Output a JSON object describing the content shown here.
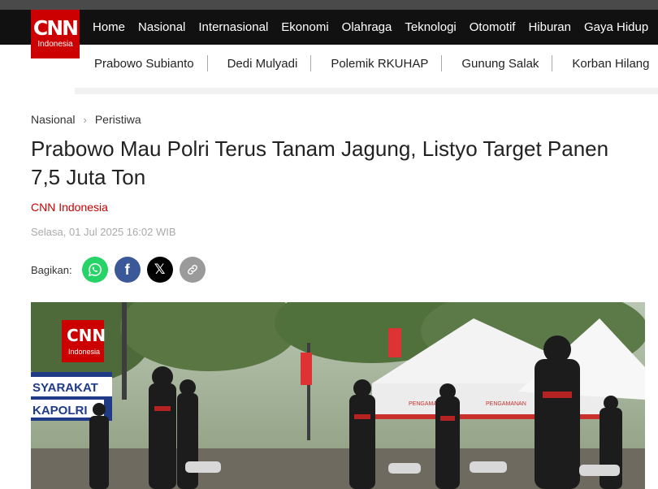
{
  "brand": {
    "logo_text": "CNN",
    "logo_sub": "Indonesia",
    "brand_color": "#cc0000"
  },
  "nav": {
    "items": [
      {
        "label": "Home"
      },
      {
        "label": "Nasional"
      },
      {
        "label": "Internasional"
      },
      {
        "label": "Ekonomi"
      },
      {
        "label": "Olahraga"
      },
      {
        "label": "Teknologi"
      },
      {
        "label": "Otomotif"
      },
      {
        "label": "Hiburan"
      },
      {
        "label": "Gaya Hidup"
      }
    ]
  },
  "subnav": {
    "items": [
      {
        "label": "Prabowo Subianto"
      },
      {
        "label": "Dedi Mulyadi"
      },
      {
        "label": "Polemik RKUHAP"
      },
      {
        "label": "Gunung Salak"
      },
      {
        "label": "Korban Hilang"
      }
    ]
  },
  "breadcrumb": {
    "section": "Nasional",
    "subsection": "Peristiwa"
  },
  "article": {
    "title": "Prabowo Mau Polri Terus Tanam Jagung, Listyo Target Panen 7,5 Juta Ton",
    "author": "CNN Indonesia",
    "date": "Selasa, 01 Jul 2025 16:02 WIB"
  },
  "share": {
    "label": "Bagikan:",
    "buttons": [
      {
        "icon": "whatsapp-icon",
        "color": "#25d366"
      },
      {
        "icon": "facebook-icon",
        "glyph": "f",
        "color": "#3b5998"
      },
      {
        "icon": "x-icon",
        "glyph": "𝕏",
        "color": "#000000"
      },
      {
        "icon": "link-icon",
        "color": "#9a9a9a"
      }
    ]
  },
  "hero": {
    "watermark_logo": "CNN",
    "watermark_sub": "Indonesia",
    "banner_text_1": "SYARAKAT",
    "banner_text_2": "KAPOLRI",
    "tent_text_1": "PENGAMANAN",
    "tent_text_2": "PENGAMANAN"
  }
}
